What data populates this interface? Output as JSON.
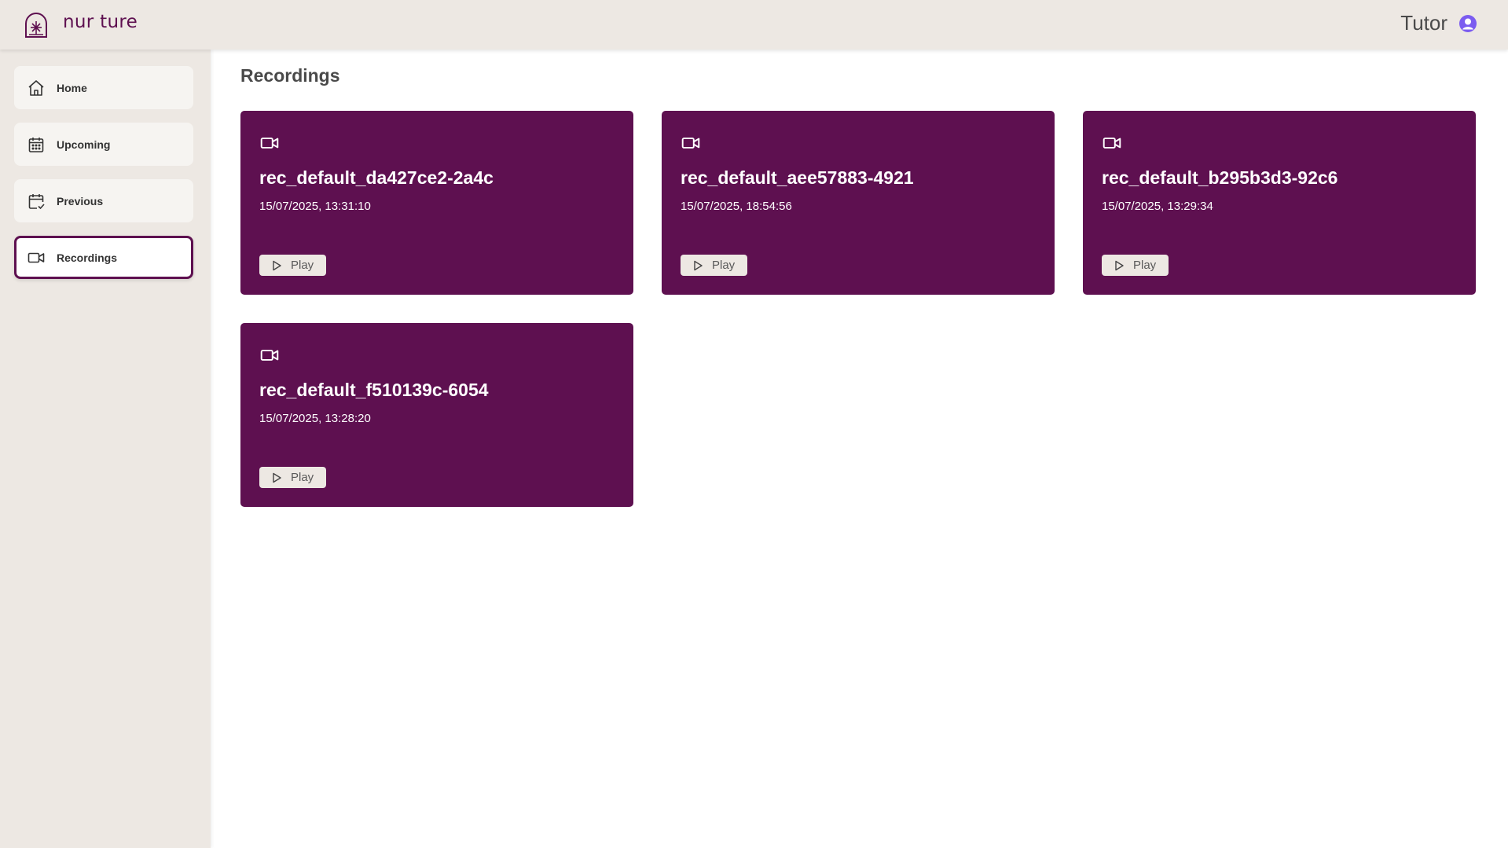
{
  "header": {
    "brand": "nur ture",
    "user_name": "Tutor"
  },
  "sidebar": {
    "items": [
      {
        "label": "Home",
        "icon": "home-icon",
        "active": false
      },
      {
        "label": "Upcoming",
        "icon": "calendar-icon",
        "active": false
      },
      {
        "label": "Previous",
        "icon": "calendar-check-icon",
        "active": false
      },
      {
        "label": "Recordings",
        "icon": "video-camera-icon",
        "active": true
      }
    ]
  },
  "main": {
    "title": "Recordings",
    "recordings": [
      {
        "name": "rec_default_da427ce2-2a4c",
        "date": "15/07/2025, 13:31:10",
        "play_label": "Play"
      },
      {
        "name": "rec_default_aee57883-4921",
        "date": "15/07/2025, 18:54:56",
        "play_label": "Play"
      },
      {
        "name": "rec_default_b295b3d3-92c6",
        "date": "15/07/2025, 13:29:34",
        "play_label": "Play"
      },
      {
        "name": "rec_default_f510139c-6054",
        "date": "15/07/2025, 13:28:20",
        "play_label": "Play"
      }
    ]
  },
  "colors": {
    "accent": "#5e1050",
    "chrome": "#ede8e3",
    "avatar": "#7b5cf0"
  }
}
